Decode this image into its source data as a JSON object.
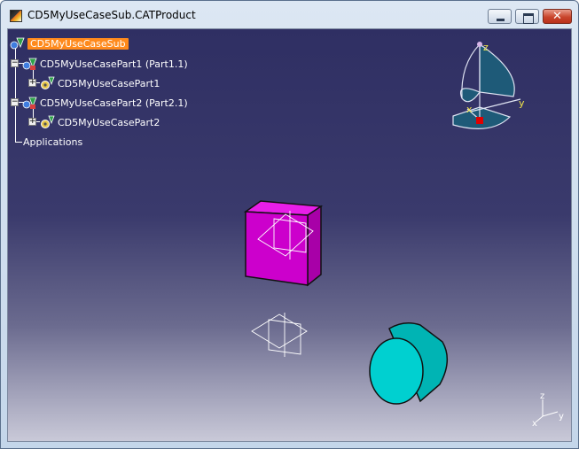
{
  "window": {
    "title": "CD5MyUseCaseSub.CATProduct",
    "controls": {
      "minimize": "minimize",
      "maximize": "maximize",
      "close": "✕"
    }
  },
  "tree": {
    "root": "CD5MyUseCaseSub",
    "part1_instance": "CD5MyUseCasePart1 (Part1.1)",
    "part1": "CD5MyUseCasePart1",
    "part2_instance": "CD5MyUseCasePart2 (Part2.1)",
    "part2": "CD5MyUseCasePart2",
    "applications": "Applications"
  },
  "compass": {
    "z": "z",
    "y": "y",
    "x": "x"
  },
  "axis_triad": {
    "z": "z",
    "y": "y",
    "x": "x"
  },
  "colors": {
    "part1_face": "#cc00cc",
    "part2_face": "#00c8c8",
    "selection": "#ff8a1c",
    "compass": "#1e6b86"
  }
}
